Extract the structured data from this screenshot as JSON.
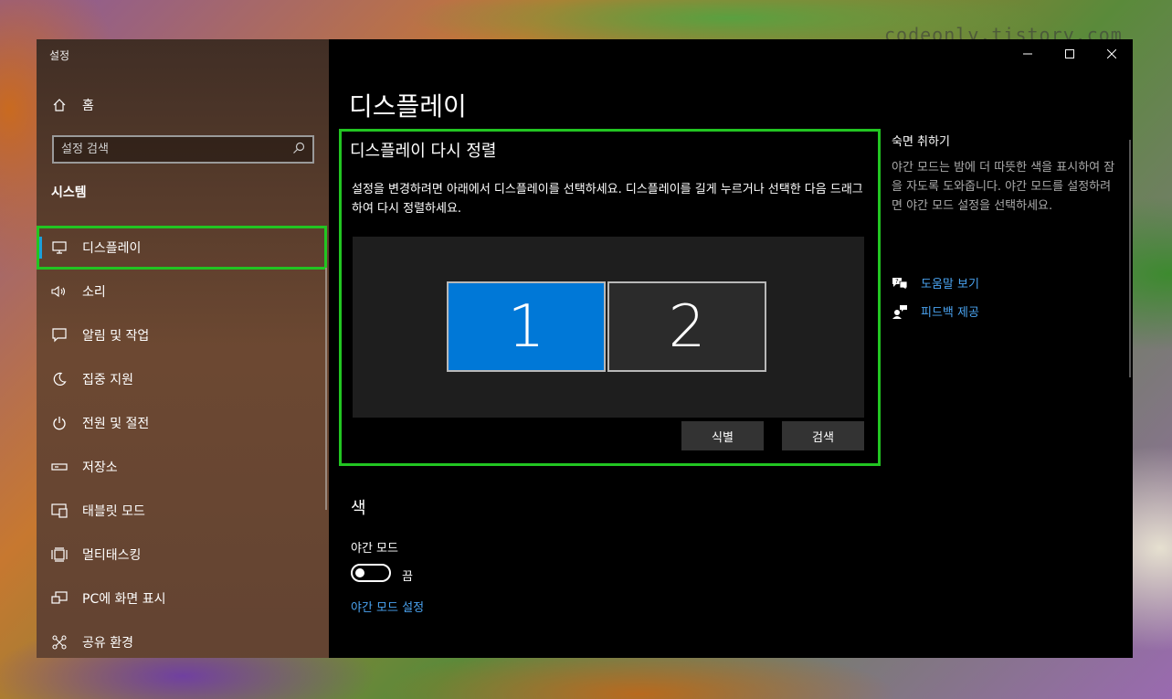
{
  "watermark": "codeonly.tistory.com",
  "window": {
    "app_title": "설정",
    "controls": {
      "minimize": "—",
      "maximize": "☐",
      "close": "✕"
    }
  },
  "nav": {
    "home": {
      "label": "홈",
      "icon": "home-icon"
    },
    "search": {
      "placeholder": "설정 검색",
      "icon": "search-icon"
    },
    "section": "시스템",
    "items": [
      {
        "label": "디스플레이",
        "icon": "monitor-icon",
        "active": true
      },
      {
        "label": "소리",
        "icon": "speaker-icon"
      },
      {
        "label": "알림 및 작업",
        "icon": "notification-icon"
      },
      {
        "label": "집중 지원",
        "icon": "moon-icon"
      },
      {
        "label": "전원 및 절전",
        "icon": "power-icon"
      },
      {
        "label": "저장소",
        "icon": "storage-icon"
      },
      {
        "label": "태블릿 모드",
        "icon": "tablet-icon"
      },
      {
        "label": "멀티태스킹",
        "icon": "multitask-icon"
      },
      {
        "label": "PC에 화면 표시",
        "icon": "project-icon"
      },
      {
        "label": "공유 환경",
        "icon": "share-icon"
      }
    ]
  },
  "main": {
    "title": "디스플레이",
    "arrange": {
      "title": "디스플레이 다시 정렬",
      "description": "설정을 변경하려면 아래에서 디스플레이를 선택하세요. 디스플레이를 길게 누르거나 선택한 다음 드래그하여 다시 정렬하세요.",
      "monitors": [
        "1",
        "2"
      ],
      "identify_label": "식별",
      "detect_label": "검색"
    },
    "color": {
      "heading": "색",
      "night_mode_label": "야간 모드",
      "toggle_state": "끔",
      "night_mode_link": "야간 모드 설정"
    }
  },
  "side": {
    "title": "숙면 취하기",
    "description": "야간 모드는 밤에 더 따뜻한 색을 표시하여 잠을 자도록 도와줍니다. 야간 모드를 설정하려면 야간 모드 설정을 선택하세요.",
    "help_link": "도움말 보기",
    "feedback_link": "피드백 제공"
  },
  "colors": {
    "accent": "#0078d7",
    "highlight": "#22c522",
    "link": "#4aa3f0"
  }
}
